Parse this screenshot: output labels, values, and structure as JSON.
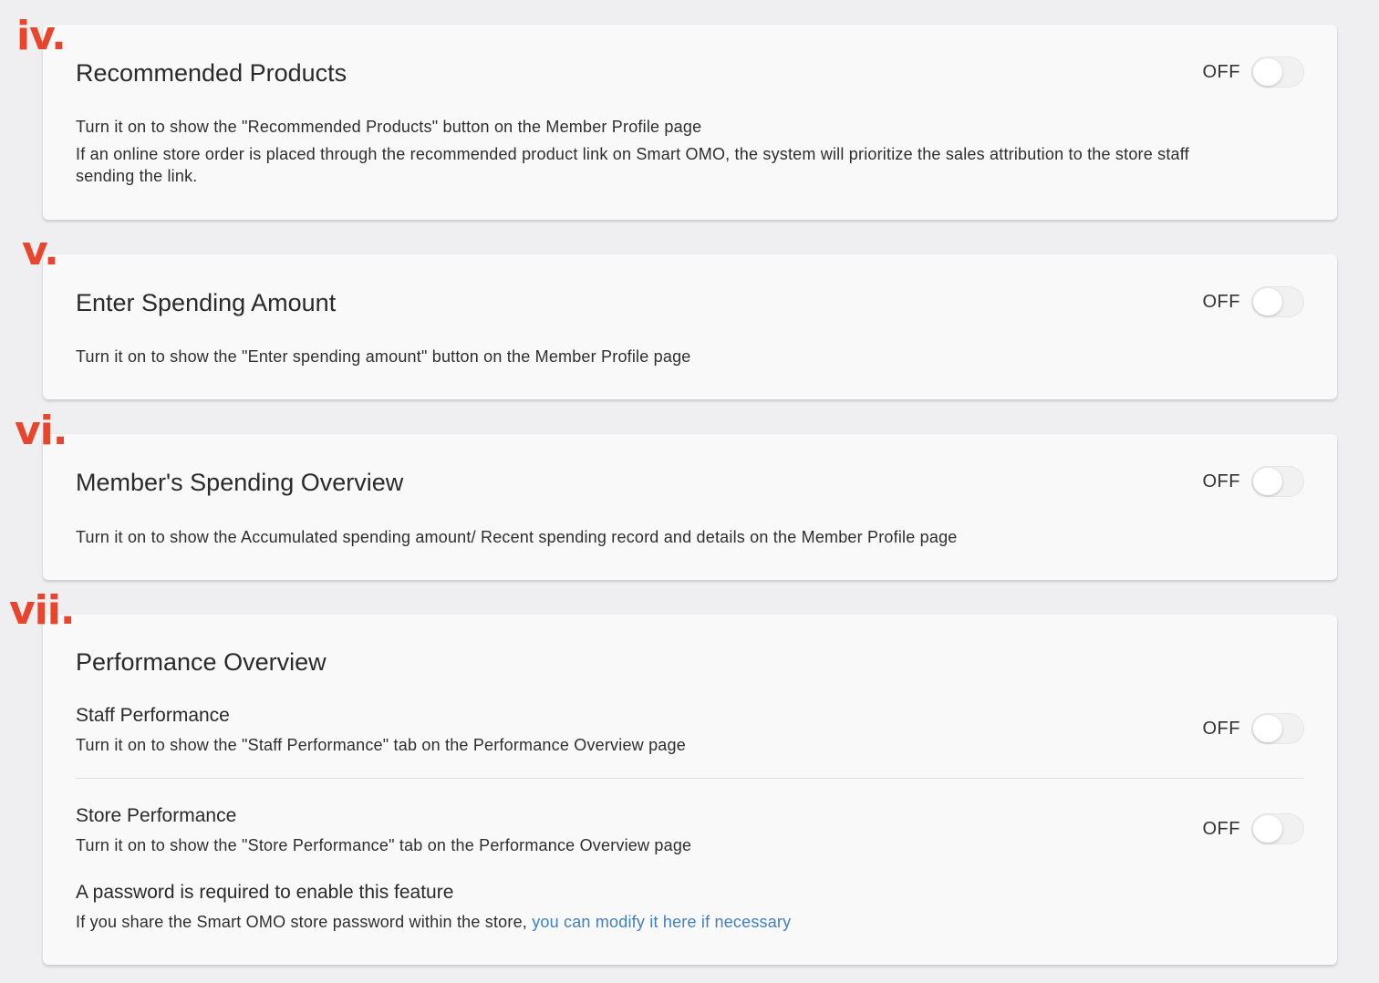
{
  "markers": [
    "iv.",
    "v.",
    "vi.",
    "vii."
  ],
  "cards": {
    "recommended": {
      "title": "Recommended Products",
      "toggle_label": "OFF",
      "lines": [
        "Turn it on to show the \"Recommended Products\" button on the Member Profile page",
        "If an online store order is placed through the recommended product link on Smart OMO, the system will prioritize the sales attribution to the store staff sending the link."
      ]
    },
    "spending_amount": {
      "title": "Enter Spending Amount",
      "toggle_label": "OFF",
      "desc": "Turn it on to show the \"Enter spending amount\" button on the Member Profile page"
    },
    "spending_overview": {
      "title": "Member's Spending Overview",
      "toggle_label": "OFF",
      "desc": "Turn it on to show the Accumulated spending amount/ Recent spending record and details on the Member Profile page"
    },
    "performance": {
      "title": "Performance Overview",
      "staff": {
        "title": "Staff Performance",
        "desc": "Turn it on to show the \"Staff Performance\" tab on the Performance Overview page",
        "toggle_label": "OFF"
      },
      "store": {
        "title": "Store Performance",
        "desc": "Turn it on to show the \"Store Performance\" tab on the Performance Overview page",
        "toggle_label": "OFF"
      },
      "password_title": "A password is required to enable this feature",
      "password_desc": "If you share the Smart OMO store password within the store,",
      "password_link": "you can modify it here if necessary"
    }
  },
  "colors": {
    "marker": "#e8452c",
    "link": "#3f7fc4",
    "background": "#efeff1",
    "card": "#f9f9f9"
  }
}
